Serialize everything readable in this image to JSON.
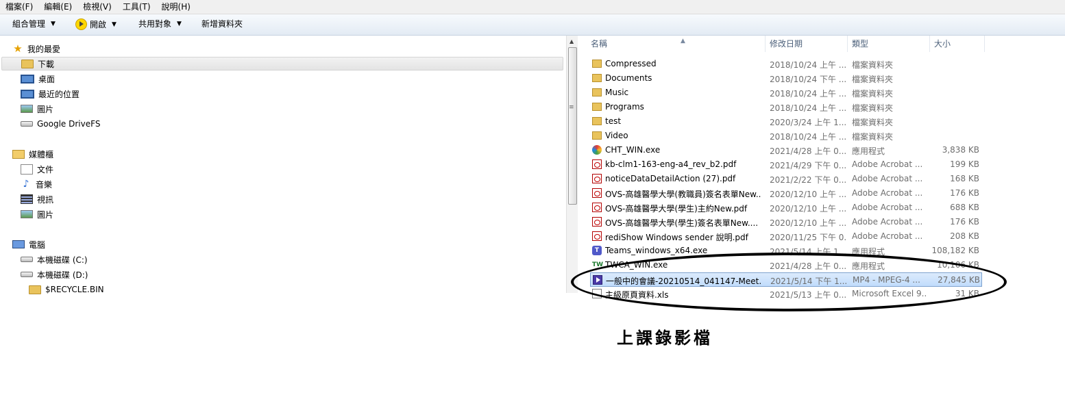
{
  "menubar": {
    "items": [
      "檔案(F)",
      "編輯(E)",
      "檢視(V)",
      "工具(T)",
      "說明(H)"
    ]
  },
  "toolbar": {
    "organize_label": "組合管理",
    "open_label": "開啟",
    "share_label": "共用對象",
    "new_folder_label": "新增資料夾"
  },
  "nav": {
    "favorites_label": "我的最愛",
    "favorites": [
      "下載",
      "桌面",
      "最近的位置",
      "圖片",
      "Google DriveFS"
    ],
    "libraries_label": "媒體櫃",
    "libraries": [
      "文件",
      "音樂",
      "視訊",
      "圖片"
    ],
    "computer_label": "電腦",
    "drives": [
      "本機磁碟 (C:)",
      "本機磁碟 (D:)"
    ],
    "subfolder": "$RECYCLE.BIN"
  },
  "columns": {
    "name": "名稱",
    "date": "修改日期",
    "type": "類型",
    "size": "大小"
  },
  "files": [
    {
      "icon": "folder-icon",
      "name": "Compressed",
      "date": "2018/10/24 上午 ...",
      "type": "檔案資料夾",
      "size": ""
    },
    {
      "icon": "folder-icon",
      "name": "Documents",
      "date": "2018/10/24 下午 ...",
      "type": "檔案資料夾",
      "size": ""
    },
    {
      "icon": "folder-icon",
      "name": "Music",
      "date": "2018/10/24 上午 ...",
      "type": "檔案資料夾",
      "size": ""
    },
    {
      "icon": "folder-icon",
      "name": "Programs",
      "date": "2018/10/24 上午 ...",
      "type": "檔案資料夾",
      "size": ""
    },
    {
      "icon": "folder-icon",
      "name": "test",
      "date": "2020/3/24 上午 1...",
      "type": "檔案資料夾",
      "size": ""
    },
    {
      "icon": "folder-icon",
      "name": "Video",
      "date": "2018/10/24 上午 ...",
      "type": "檔案資料夾",
      "size": ""
    },
    {
      "icon": "cht-app-icon",
      "name": "CHT_WIN.exe",
      "date": "2021/4/28 上午 0...",
      "type": "應用程式",
      "size": "3,838 KB"
    },
    {
      "icon": "pdf-icon",
      "name": "kb-clm1-163-eng-a4_rev_b2.pdf",
      "date": "2021/4/29 下午 0...",
      "type": "Adobe Acrobat ...",
      "size": "199 KB"
    },
    {
      "icon": "pdf-icon",
      "name": "noticeDataDetailAction (27).pdf",
      "date": "2021/2/22 下午 0...",
      "type": "Adobe Acrobat ...",
      "size": "168 KB"
    },
    {
      "icon": "pdf-icon",
      "name": "OVS-高雄醫學大學(教職員)簽名表單New...",
      "date": "2020/12/10 上午 ...",
      "type": "Adobe Acrobat ...",
      "size": "176 KB"
    },
    {
      "icon": "pdf-icon",
      "name": "OVS-高雄醫學大學(學生)主約New.pdf",
      "date": "2020/12/10 上午 ...",
      "type": "Adobe Acrobat ...",
      "size": "688 KB"
    },
    {
      "icon": "pdf-icon",
      "name": "OVS-高雄醫學大學(學生)簽名表單New....",
      "date": "2020/12/10 上午 ...",
      "type": "Adobe Acrobat ...",
      "size": "176 KB"
    },
    {
      "icon": "pdf-icon",
      "name": "rediShow Windows sender 說明.pdf",
      "date": "2020/11/25 下午 0...",
      "type": "Adobe Acrobat ...",
      "size": "208 KB"
    },
    {
      "icon": "teams-icon",
      "name": "Teams_windows_x64.exe",
      "date": "2021/5/14 上午 1...",
      "type": "應用程式",
      "size": "108,182 KB"
    },
    {
      "icon": "twca-icon",
      "name": "TWCA_WIN.exe",
      "date": "2021/4/28 上午 0...",
      "type": "應用程式",
      "size": "10,106 KB"
    },
    {
      "icon": "mp4-icon",
      "name": "一般中的會議-20210514_041147-Meet...",
      "date": "2021/5/14 下午 1...",
      "type": "MP4 - MPEG-4 ...",
      "size": "27,845 KB"
    },
    {
      "icon": "excel-icon",
      "name": "主級原頁資料.xls",
      "date": "2021/5/13 上午 0...",
      "type": "Microsoft Excel 9...",
      "size": "31 KB"
    }
  ],
  "annotation": "上課錄影檔"
}
